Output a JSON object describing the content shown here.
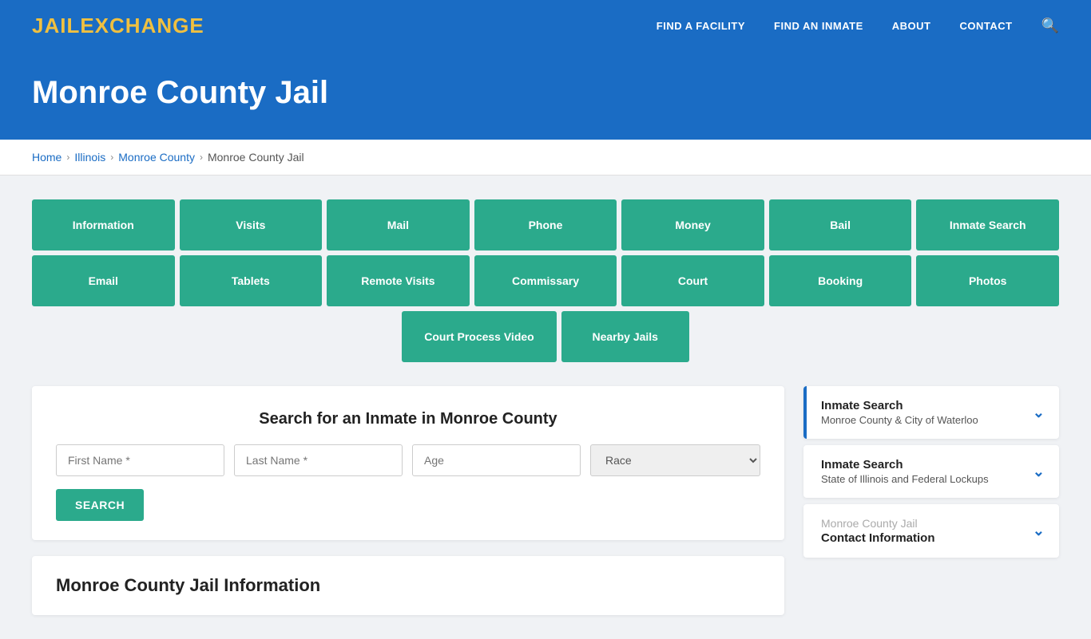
{
  "nav": {
    "logo_part1": "JAIL",
    "logo_exchange": "EXCHANGE",
    "links": [
      {
        "label": "FIND A FACILITY",
        "id": "find-facility"
      },
      {
        "label": "FIND AN INMATE",
        "id": "find-inmate"
      },
      {
        "label": "ABOUT",
        "id": "about"
      },
      {
        "label": "CONTACT",
        "id": "contact"
      }
    ]
  },
  "hero": {
    "title": "Monroe County Jail"
  },
  "breadcrumb": {
    "items": [
      "Home",
      "Illinois",
      "Monroe County",
      "Monroe County Jail"
    ]
  },
  "buttons_row1": [
    "Information",
    "Visits",
    "Mail",
    "Phone",
    "Money",
    "Bail",
    "Inmate Search"
  ],
  "buttons_row2": [
    "Email",
    "Tablets",
    "Remote Visits",
    "Commissary",
    "Court",
    "Booking",
    "Photos"
  ],
  "buttons_row3": [
    "Court Process Video",
    "Nearby Jails"
  ],
  "search": {
    "title": "Search for an Inmate in Monroe County",
    "first_name_placeholder": "First Name *",
    "last_name_placeholder": "Last Name *",
    "age_placeholder": "Age",
    "race_placeholder": "Race",
    "button_label": "SEARCH"
  },
  "info_section": {
    "title": "Monroe County Jail Information"
  },
  "sidebar": {
    "cards": [
      {
        "top": "Inmate Search",
        "bottom": "Monroe County & City of Waterloo",
        "active": true
      },
      {
        "top": "Inmate Search",
        "bottom": "State of Illinois and Federal Lockups",
        "active": false
      },
      {
        "top": "Monroe County Jail",
        "bottom": "Contact Information",
        "contact": true,
        "active": false
      }
    ]
  }
}
